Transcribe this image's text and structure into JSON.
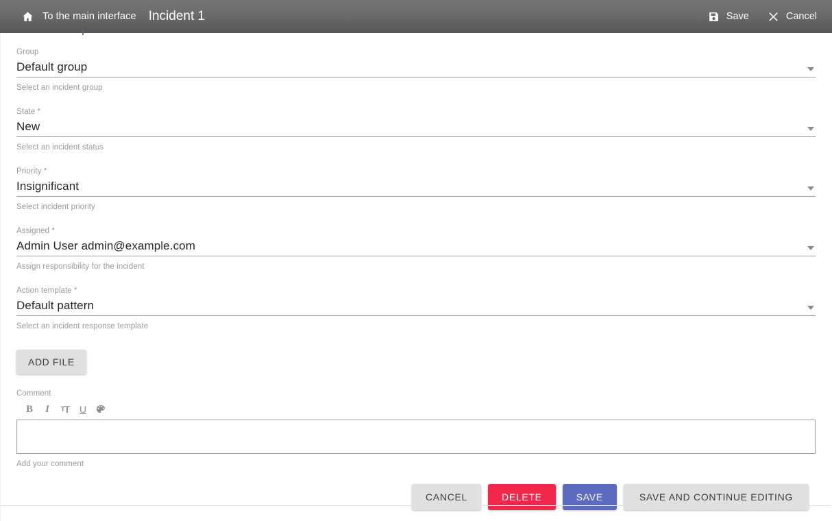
{
  "header": {
    "home_icon": "home-icon",
    "main_link": "To the main interface",
    "title": "Incident 1",
    "save_icon": "floppy-disk-save-icon",
    "save_label": "Save",
    "cancel_icon": "close-x-icon",
    "cancel_label": "Cancel"
  },
  "form": {
    "fields": [
      {
        "label": "Group",
        "required": false,
        "value": "Default group",
        "hint": "Select an incident group",
        "caret_icon": "chevron-down-icon"
      },
      {
        "label": "State",
        "required": true,
        "value": "New",
        "hint": "Select an incident status",
        "caret_icon": "chevron-down-icon"
      },
      {
        "label": "Priority",
        "required": true,
        "value": "Insignificant",
        "hint": "Select incident priority",
        "caret_icon": "chevron-down-icon"
      },
      {
        "label": "Assigned",
        "required": true,
        "value": "Admin User admin@example.com",
        "hint": "Assign responsibility for the incident",
        "caret_icon": "chevron-down-icon"
      },
      {
        "label": "Action template",
        "required": true,
        "value": "Default pattern",
        "hint": "Select an incident response template",
        "caret_icon": "chevron-down-icon"
      }
    ],
    "add_file_label": "ADD FILE",
    "comment": {
      "label": "Comment",
      "value": "",
      "placeholder": "",
      "hint": "Add your comment",
      "toolbar": [
        {
          "name": "bold-icon",
          "glyph": "B"
        },
        {
          "name": "italic-icon",
          "glyph": "I"
        },
        {
          "name": "font-size-icon",
          "glyph": "T"
        },
        {
          "name": "underline-icon",
          "glyph": "U"
        },
        {
          "name": "color-palette-icon",
          "glyph": "palette"
        }
      ]
    }
  },
  "footer": {
    "cancel_label": "CANCEL",
    "delete_label": "DELETE",
    "save_label": "SAVE",
    "save_continue_label": "SAVE AND CONTINUE EDITING"
  },
  "colors": {
    "header_bg": "#6b6b6b",
    "delete_red": "#f2274c",
    "save_blue": "#5c6bc0",
    "grey_button": "#e0e0e0",
    "label_grey": "#9a9a9a",
    "value_dark": "#262626",
    "underline": "#9e9e9e"
  }
}
